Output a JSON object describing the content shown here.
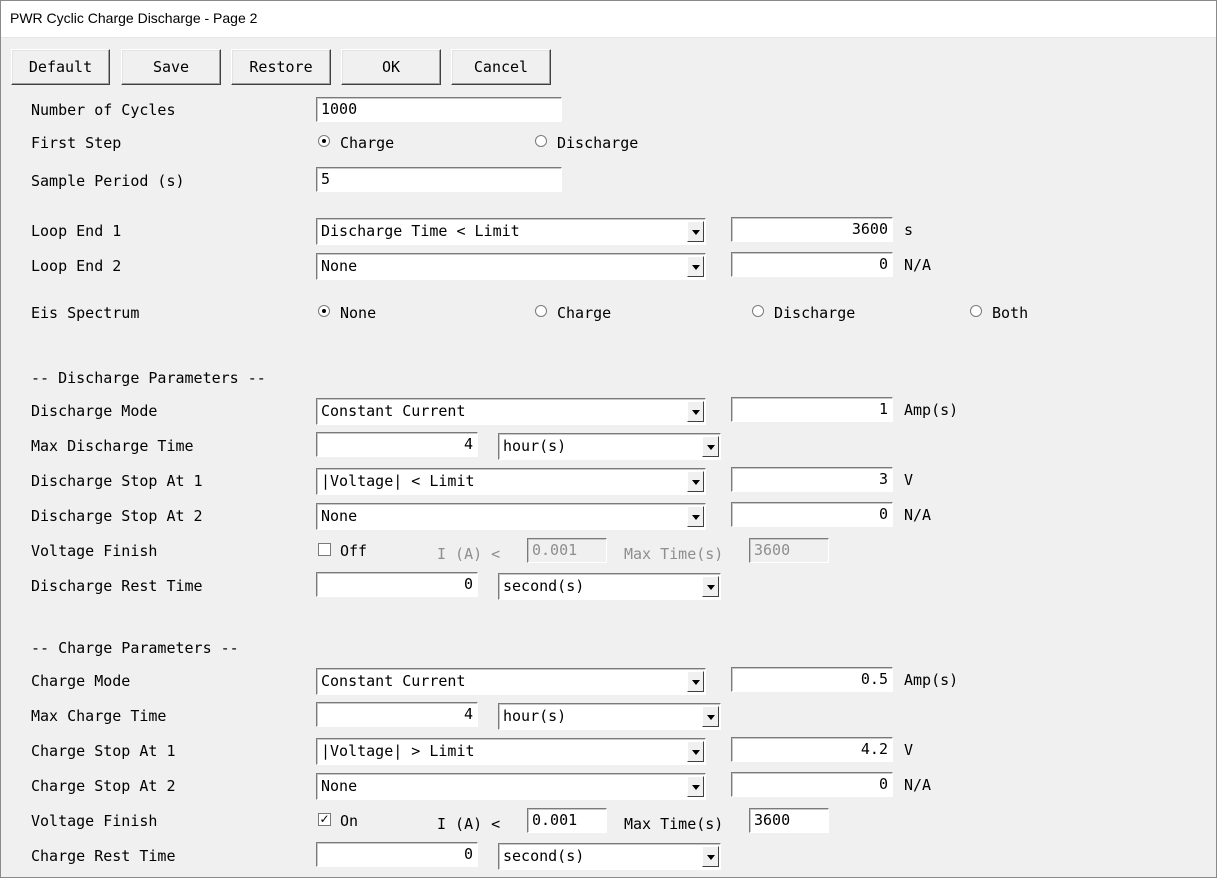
{
  "window": {
    "title": "PWR Cyclic Charge Discharge - Page 2"
  },
  "toolbar": {
    "default": "Default",
    "save": "Save",
    "restore": "Restore",
    "ok": "OK",
    "cancel": "Cancel"
  },
  "cycles": {
    "label": "Number of Cycles",
    "value": "1000"
  },
  "first_step": {
    "label": "First Step",
    "charge": "Charge",
    "discharge": "Discharge",
    "selected": "charge"
  },
  "sample_period": {
    "label": "Sample Period (s)",
    "value": "5"
  },
  "loop_end_1": {
    "label": "Loop End 1",
    "selection": "Discharge Time < Limit",
    "value": "3600",
    "unit": "s"
  },
  "loop_end_2": {
    "label": "Loop End 2",
    "selection": "None",
    "value": "0",
    "unit": "N/A"
  },
  "eis": {
    "label": "Eis Spectrum",
    "none": "None",
    "charge": "Charge",
    "discharge": "Discharge",
    "both": "Both",
    "selected": "none"
  },
  "discharge": {
    "header": "-- Discharge Parameters --",
    "mode": {
      "label": "Discharge Mode",
      "selection": "Constant Current",
      "value": "1",
      "unit": "Amp(s)"
    },
    "max_time": {
      "label": "Max Discharge Time",
      "value": "4",
      "unit": "hour(s)"
    },
    "stop1": {
      "label": "Discharge Stop At 1",
      "selection": "|Voltage| < Limit",
      "value": "3",
      "unit": "V"
    },
    "stop2": {
      "label": "Discharge Stop At 2",
      "selection": "None",
      "value": "0",
      "unit": "N/A"
    },
    "voltage_finish": {
      "label": "Voltage Finish",
      "state": "Off",
      "i_label": "I (A) <",
      "i_value": "0.001",
      "max_label": "Max Time(s)",
      "max_value": "3600"
    },
    "rest": {
      "label": "Discharge Rest Time",
      "value": "0",
      "unit": "second(s)"
    }
  },
  "charge": {
    "header": "-- Charge Parameters --",
    "mode": {
      "label": "Charge Mode",
      "selection": "Constant Current",
      "value": "0.5",
      "unit": "Amp(s)"
    },
    "max_time": {
      "label": "Max Charge Time",
      "value": "4",
      "unit": "hour(s)"
    },
    "stop1": {
      "label": "Charge Stop At 1",
      "selection": "|Voltage| > Limit",
      "value": "4.2",
      "unit": "V"
    },
    "stop2": {
      "label": "Charge Stop At 2",
      "selection": "None",
      "value": "0",
      "unit": "N/A"
    },
    "voltage_finish": {
      "label": "Voltage Finish",
      "state": "On",
      "i_label": "I (A) <",
      "i_value": "0.001",
      "max_label": "Max Time(s)",
      "max_value": "3600"
    },
    "rest": {
      "label": "Charge Rest Time",
      "value": "0",
      "unit": "second(s)"
    }
  },
  "icons": {
    "check": "✓"
  }
}
